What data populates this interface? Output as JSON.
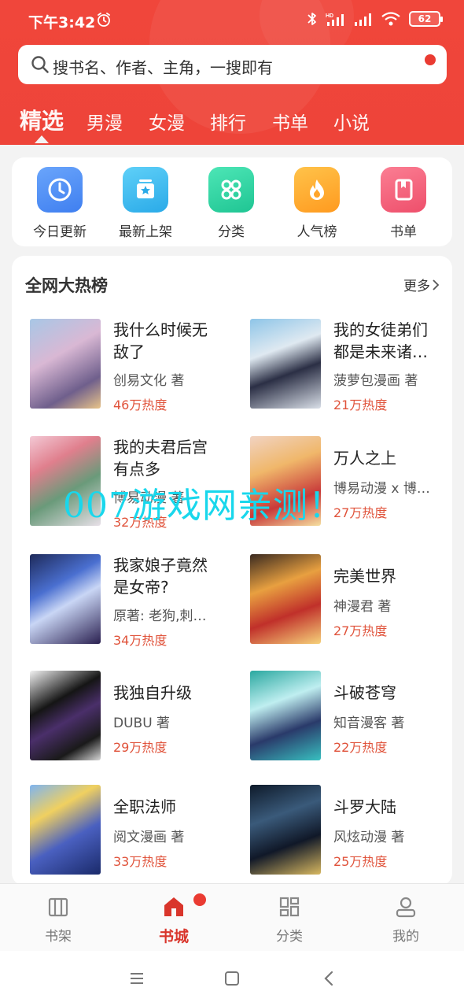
{
  "status": {
    "time": "下午3:42",
    "battery": "62",
    "network_label": "HD"
  },
  "search": {
    "placeholder": "搜书名、作者、主角，一搜即有"
  },
  "tabs": [
    {
      "label": "精选",
      "active": true
    },
    {
      "label": "男漫"
    },
    {
      "label": "女漫"
    },
    {
      "label": "排行"
    },
    {
      "label": "书单"
    },
    {
      "label": "小说"
    }
  ],
  "quick_entries": [
    {
      "label": "今日更新",
      "icon": "clock-icon",
      "color": "#4f8ef7"
    },
    {
      "label": "最新上架",
      "icon": "new-shelf-icon",
      "color": "#3fb8f0"
    },
    {
      "label": "分类",
      "icon": "category-grid-icon",
      "color": "#2fd6a5"
    },
    {
      "label": "人气榜",
      "icon": "fire-icon",
      "color": "#ffa72e"
    },
    {
      "label": "书单",
      "icon": "booklist-icon",
      "color": "#f3607a"
    }
  ],
  "hot": {
    "title": "全网大热榜",
    "more": "更多",
    "books": [
      {
        "title": "我什么时候无敌了",
        "author": "创易文化 著",
        "heat": "46万热度"
      },
      {
        "title": "我的女徒弟们都是未来诸…",
        "author": "菠萝包漫画 著",
        "heat": "21万热度"
      },
      {
        "title": "我的夫君后宫有点多",
        "author": "博易动漫 著",
        "heat": "32万热度"
      },
      {
        "title": "万人之上",
        "author": "博易动漫 x 博…",
        "heat": "27万热度"
      },
      {
        "title": "我家娘子竟然是女帝?",
        "author": "原著: 老狗,刺…",
        "heat": "34万热度"
      },
      {
        "title": "完美世界",
        "author": "神漫君 著",
        "heat": "27万热度"
      },
      {
        "title": "我独自升级",
        "author": "DUBU 著",
        "heat": "29万热度"
      },
      {
        "title": "斗破苍穹",
        "author": "知音漫客 著",
        "heat": "22万热度"
      },
      {
        "title": "全职法师",
        "author": "阅文漫画 著",
        "heat": "33万热度"
      },
      {
        "title": "斗罗大陆",
        "author": "风炫动漫 著",
        "heat": "25万热度"
      }
    ]
  },
  "watermark": "007游戏网亲测！",
  "bottom_nav": [
    {
      "label": "书架",
      "icon": "bookshelf-icon"
    },
    {
      "label": "书城",
      "icon": "home-icon",
      "active": true
    },
    {
      "label": "分类",
      "icon": "category-icon"
    },
    {
      "label": "我的",
      "icon": "profile-icon"
    }
  ],
  "colors": {
    "brand_red": "#ef4439",
    "heat_text": "#e0533b",
    "active_nav": "#d9352b"
  }
}
